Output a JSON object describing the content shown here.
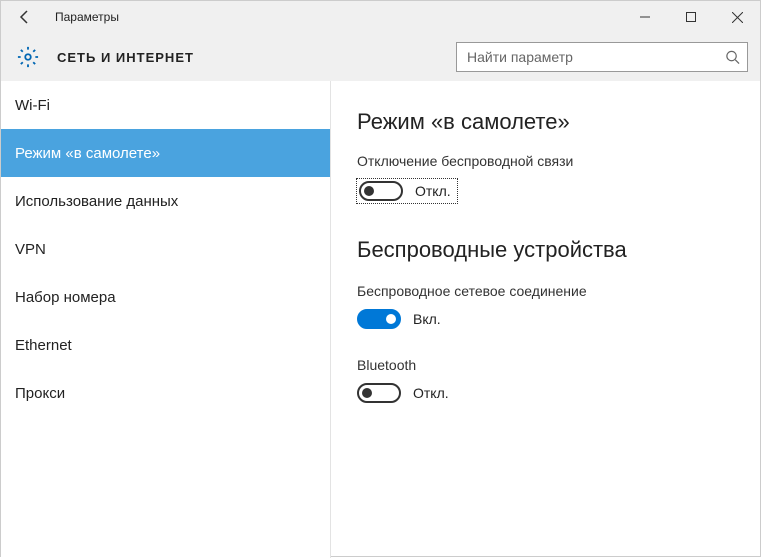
{
  "titlebar": {
    "title": "Параметры"
  },
  "header": {
    "section": "СЕТЬ И ИНТЕРНЕТ",
    "search_placeholder": "Найти параметр"
  },
  "sidebar": {
    "items": [
      {
        "label": "Wi-Fi",
        "selected": false
      },
      {
        "label": "Режим «в самолете»",
        "selected": true
      },
      {
        "label": "Использование данных",
        "selected": false
      },
      {
        "label": "VPN",
        "selected": false
      },
      {
        "label": "Набор номера",
        "selected": false
      },
      {
        "label": "Ethernet",
        "selected": false
      },
      {
        "label": "Прокси",
        "selected": false
      }
    ]
  },
  "content": {
    "airplane": {
      "heading": "Режим «в самолете»",
      "desc": "Отключение беспроводной связи",
      "toggle_state": "off",
      "toggle_label": "Откл."
    },
    "wireless": {
      "heading": "Беспроводные устройства",
      "network_label": "Беспроводное сетевое соединение",
      "network_toggle_state": "on",
      "network_toggle_label": "Вкл.",
      "bluetooth_label": "Bluetooth",
      "bluetooth_toggle_state": "off",
      "bluetooth_toggle_label": "Откл."
    }
  }
}
